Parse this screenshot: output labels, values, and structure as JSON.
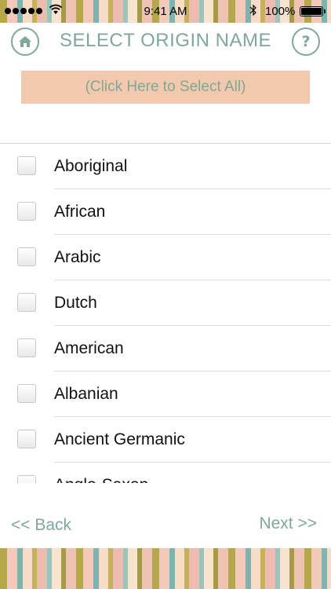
{
  "status_bar": {
    "time": "9:41 AM",
    "battery": "100%"
  },
  "header": {
    "title": "SELECT ORIGIN NAME",
    "help_label": "?"
  },
  "select_all_label": "(Click Here to Select All)",
  "origins": [
    {
      "label": "Aboriginal",
      "checked": false
    },
    {
      "label": "African",
      "checked": false
    },
    {
      "label": "Arabic",
      "checked": false
    },
    {
      "label": "Dutch",
      "checked": false
    },
    {
      "label": "American",
      "checked": false
    },
    {
      "label": "Albanian",
      "checked": false
    },
    {
      "label": "Ancient Germanic",
      "checked": false
    },
    {
      "label": "Anglo-Saxon",
      "checked": false
    }
  ],
  "footer": {
    "back_label": "<< Back",
    "next_label": "Next >>"
  },
  "colors": {
    "accent": "#7fa896",
    "select_all_bg": "#f2c9ae"
  }
}
